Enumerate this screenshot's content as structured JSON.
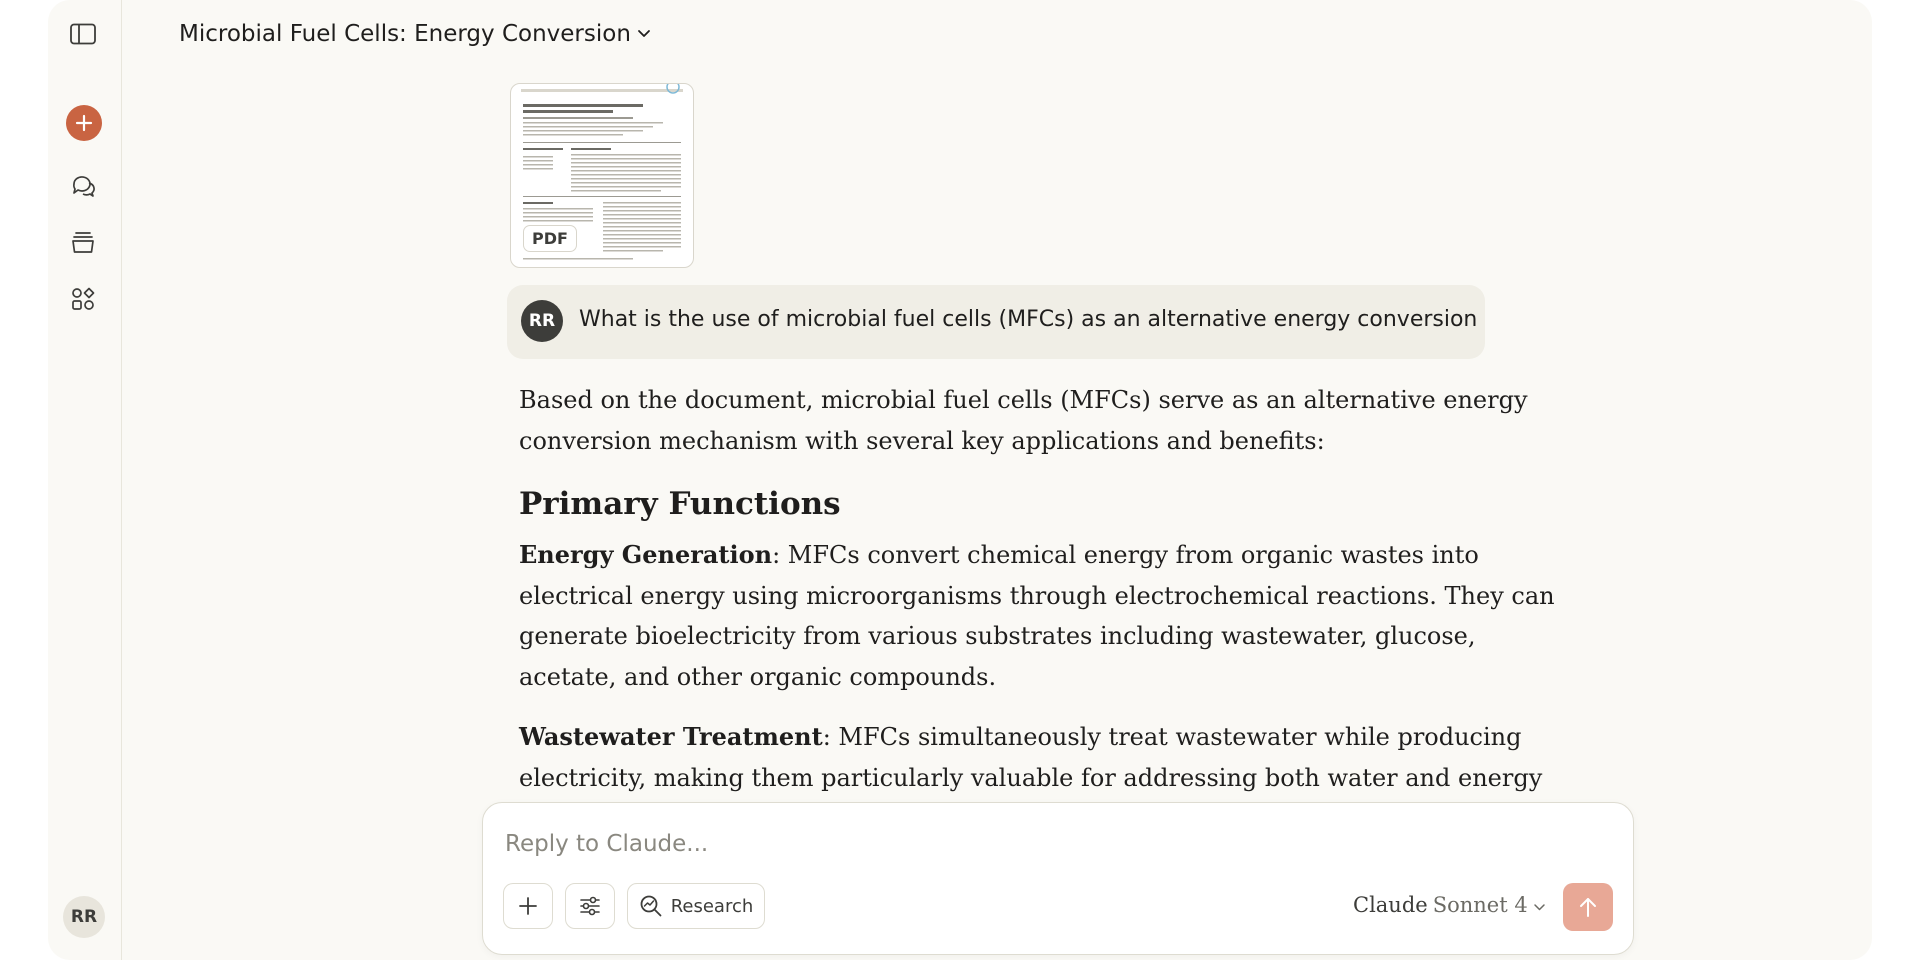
{
  "header": {
    "title": "Microbial Fuel Cells: Energy Conversion"
  },
  "sidebar": {
    "icons": [
      "sidebar-toggle-icon",
      "plus-icon",
      "chats-icon",
      "projects-icon",
      "artifacts-icon"
    ],
    "avatar_initials": "RR",
    "accent": "#c96442"
  },
  "attachment": {
    "type_label": "PDF"
  },
  "user_message": {
    "avatar_initials": "RR",
    "text": "What is the use of microbial fuel cells (MFCs) as an alternative energy conversion"
  },
  "answer": {
    "intro": "Based on the document, microbial fuel cells (MFCs) serve as an alternative energy conversion mechanism with several key applications and benefits:",
    "heading": "Primary Functions",
    "items": [
      {
        "title": "Energy Generation",
        "text": ": MFCs convert chemical energy from organic wastes into electrical energy using microorganisms through electrochemical reactions. They can generate bioelectricity from various substrates including wastewater, glucose, acetate, and other organic compounds."
      },
      {
        "title": "Wastewater Treatment",
        "text": ": MFCs simultaneously treat wastewater while producing electricity, making them particularly valuable for addressing both water and energy challenges. They can"
      }
    ]
  },
  "composer": {
    "placeholder": "Reply to Claude...",
    "research_label": "Research",
    "model_name": "Claude",
    "model_version": "Sonnet 4",
    "send_color": "#e8a896"
  }
}
